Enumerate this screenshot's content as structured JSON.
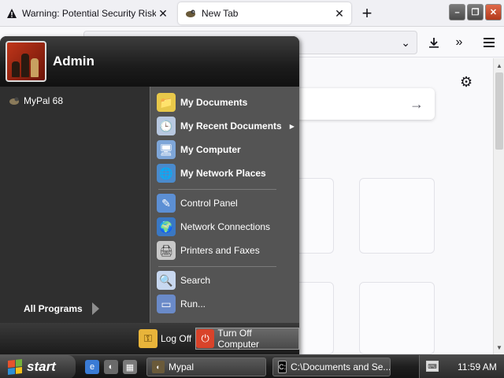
{
  "browser": {
    "tabs": [
      {
        "title": "Warning: Potential Security Risk Ah",
        "icon": "warning-icon",
        "active": false
      },
      {
        "title": "New Tab",
        "icon": "mypal-icon",
        "active": true
      }
    ],
    "new_tab_symbol": "+",
    "close_symbol": "✕",
    "window_controls": {
      "minimize": "–",
      "maximize": "❐",
      "close": "✕"
    }
  },
  "newtab_page": {
    "search_arrow": "→",
    "settings_icon": "gear-icon"
  },
  "start_menu": {
    "user_name": "Admin",
    "pinned": [
      {
        "label": "MyPal 68",
        "icon": "mypal-icon"
      }
    ],
    "all_programs": "All Programs",
    "places": [
      {
        "label": "My Documents",
        "icon": "folder-documents-icon",
        "color": "#e8c84a"
      },
      {
        "label": "My Recent Documents",
        "icon": "recent-documents-icon",
        "color": "#b8c8e0",
        "submenu": true
      },
      {
        "label": "My Computer",
        "icon": "computer-icon",
        "color": "#7ea6d8"
      },
      {
        "label": "My Network Places",
        "icon": "network-places-icon",
        "color": "#4a8acc"
      }
    ],
    "system": [
      {
        "label": "Control Panel",
        "icon": "control-panel-icon",
        "color": "#5c8fd4"
      },
      {
        "label": "Network Connections",
        "icon": "network-connections-icon",
        "color": "#3a78c4"
      },
      {
        "label": "Printers and Faxes",
        "icon": "printer-icon",
        "color": "#c8c8c8"
      }
    ],
    "tools": [
      {
        "label": "Search",
        "icon": "search-icon",
        "color": "#c8d8f0"
      },
      {
        "label": "Run...",
        "icon": "run-icon",
        "color": "#6a8ac8"
      }
    ],
    "footer": {
      "log_off": "Log Off",
      "turn_off": "Turn Off Computer"
    }
  },
  "taskbar": {
    "start_label": "start",
    "quick_launch": [
      {
        "icon": "internet-explorer-icon",
        "color": "#3a7bd5"
      },
      {
        "icon": "mypal-quicklaunch-icon",
        "color": "#6a6a6a"
      },
      {
        "icon": "show-desktop-icon",
        "color": "#7a7a7a"
      }
    ],
    "tasks": [
      {
        "label": "Mypal",
        "icon": "mypal-icon"
      },
      {
        "label": "C:\\Documents and Se...",
        "icon": "cmd-icon"
      }
    ],
    "clock": "11:59 AM"
  },
  "colors": {
    "accent_green": "#3c8f3c",
    "turn_off_red": "#d9432a"
  }
}
